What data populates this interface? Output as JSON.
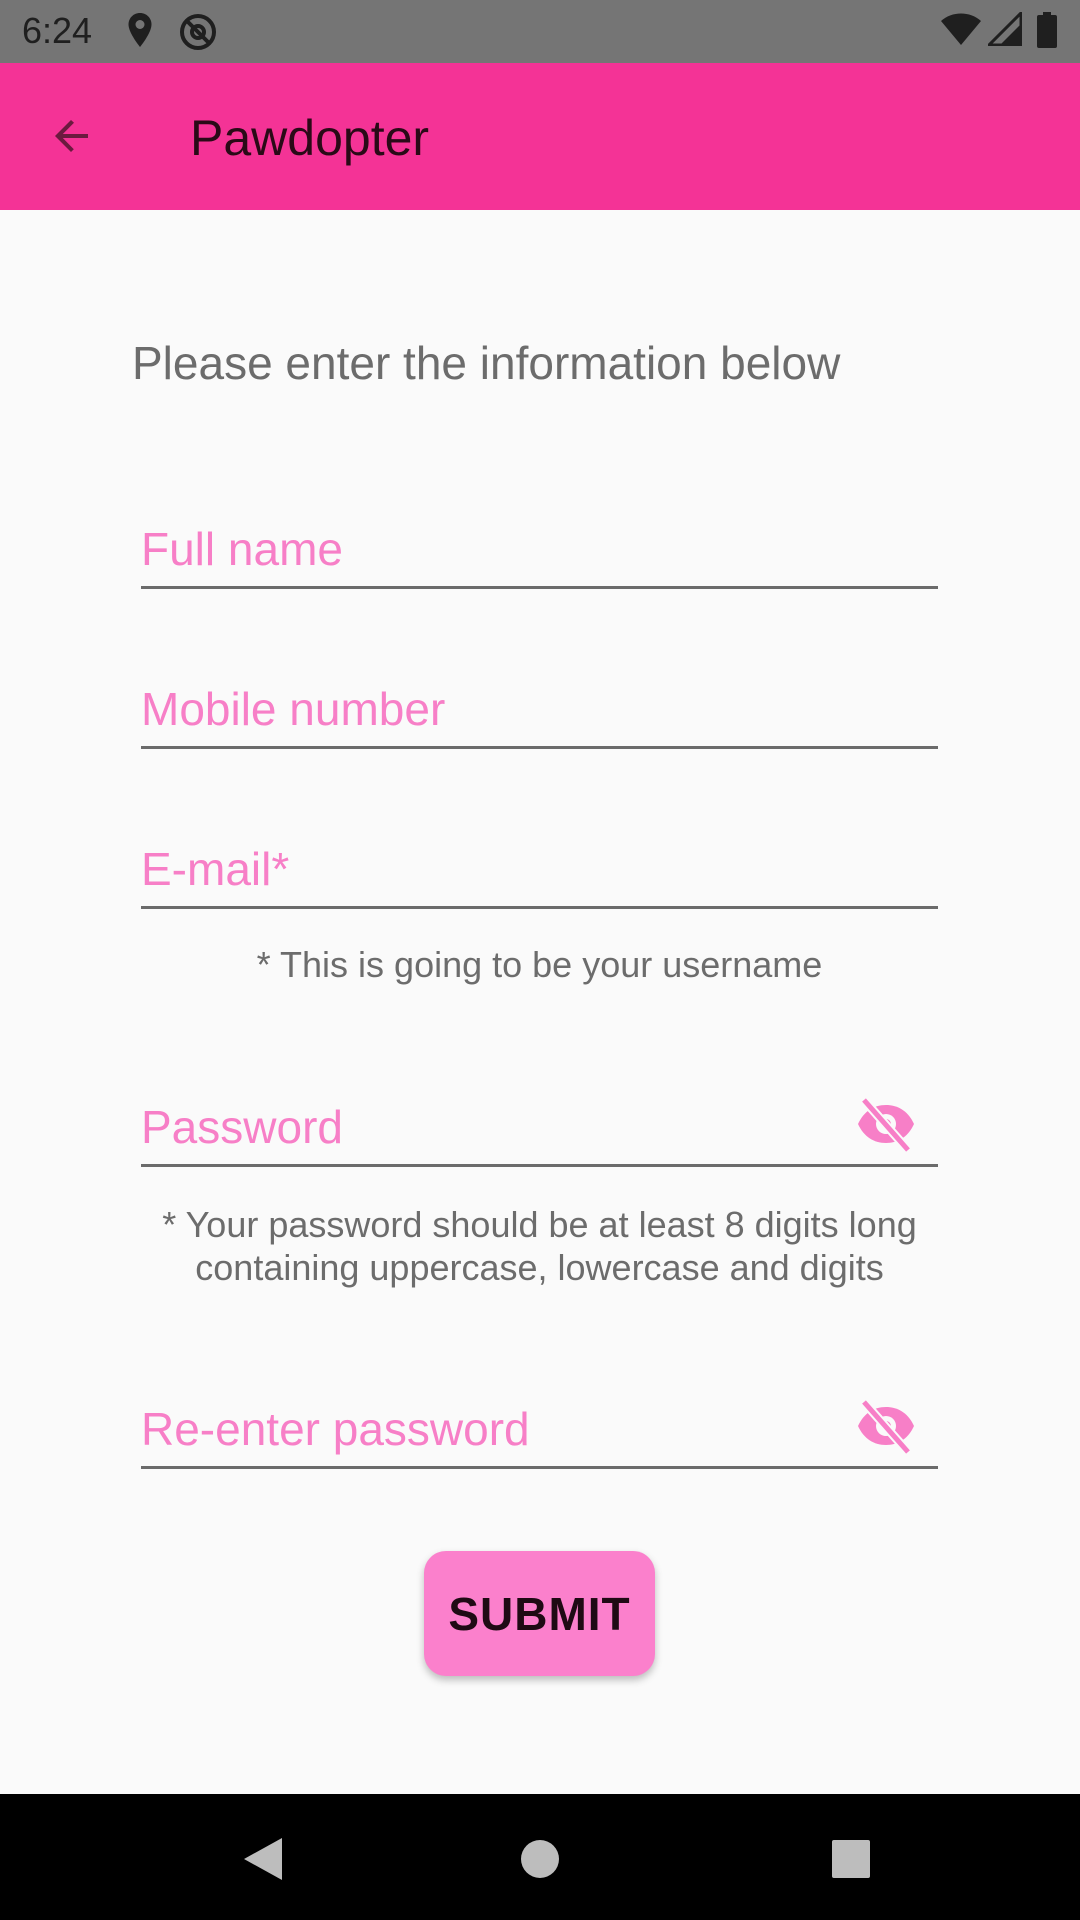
{
  "status_bar": {
    "time": "6:24",
    "icons": [
      "location-icon",
      "at-sign-icon",
      "wifi-icon",
      "signal-icon",
      "battery-icon"
    ]
  },
  "app_bar": {
    "title": "Pawdopter",
    "back_icon": "arrow-back-icon",
    "color": "#f43396"
  },
  "form": {
    "subtitle": "Please enter the information below",
    "full_name_placeholder": "Full name",
    "mobile_placeholder": "Mobile number",
    "email_placeholder": "E-mail*",
    "email_hint": "* This is going to be your username",
    "password_placeholder": "Password",
    "password_hint_line1": "* Your password should be at least 8 digits long",
    "password_hint_line2": "containing uppercase, lowercase and digits",
    "reenter_placeholder": "Re-enter password",
    "visibility_icon": "visibility-off-icon",
    "submit_label": "SUBMIT",
    "accent_color": "#f77fc7"
  },
  "nav_bar": {
    "icons": [
      "back-triangle-icon",
      "home-circle-icon",
      "recents-square-icon"
    ]
  }
}
